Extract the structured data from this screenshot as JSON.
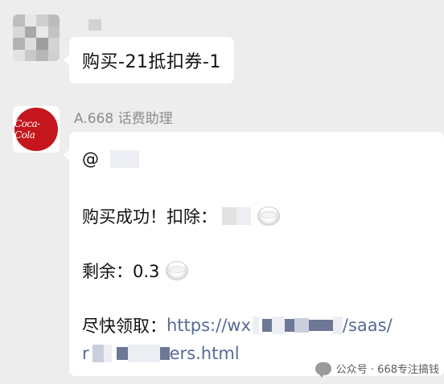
{
  "messages": [
    {
      "sender": "",
      "text": "购买-21抵扣券-1"
    },
    {
      "sender": "A.668 话费助理",
      "avatar_text": "Coca-Cola",
      "lines": {
        "mention": "@",
        "success_label": "购买成功！扣除：",
        "balance_label": "剩余：0.3",
        "claim_label": "尽快领取：",
        "link_part1": "https://wx",
        "link_part2": "/saas/",
        "link_part3": "r",
        "link_part4": "ers.html"
      }
    }
  ],
  "watermark": {
    "text": "公众号 · 668专注搞钱"
  },
  "colors": {
    "background": "#ededed",
    "bubble": "#ffffff",
    "link": "#576b95",
    "brand_red": "#c4161c"
  }
}
